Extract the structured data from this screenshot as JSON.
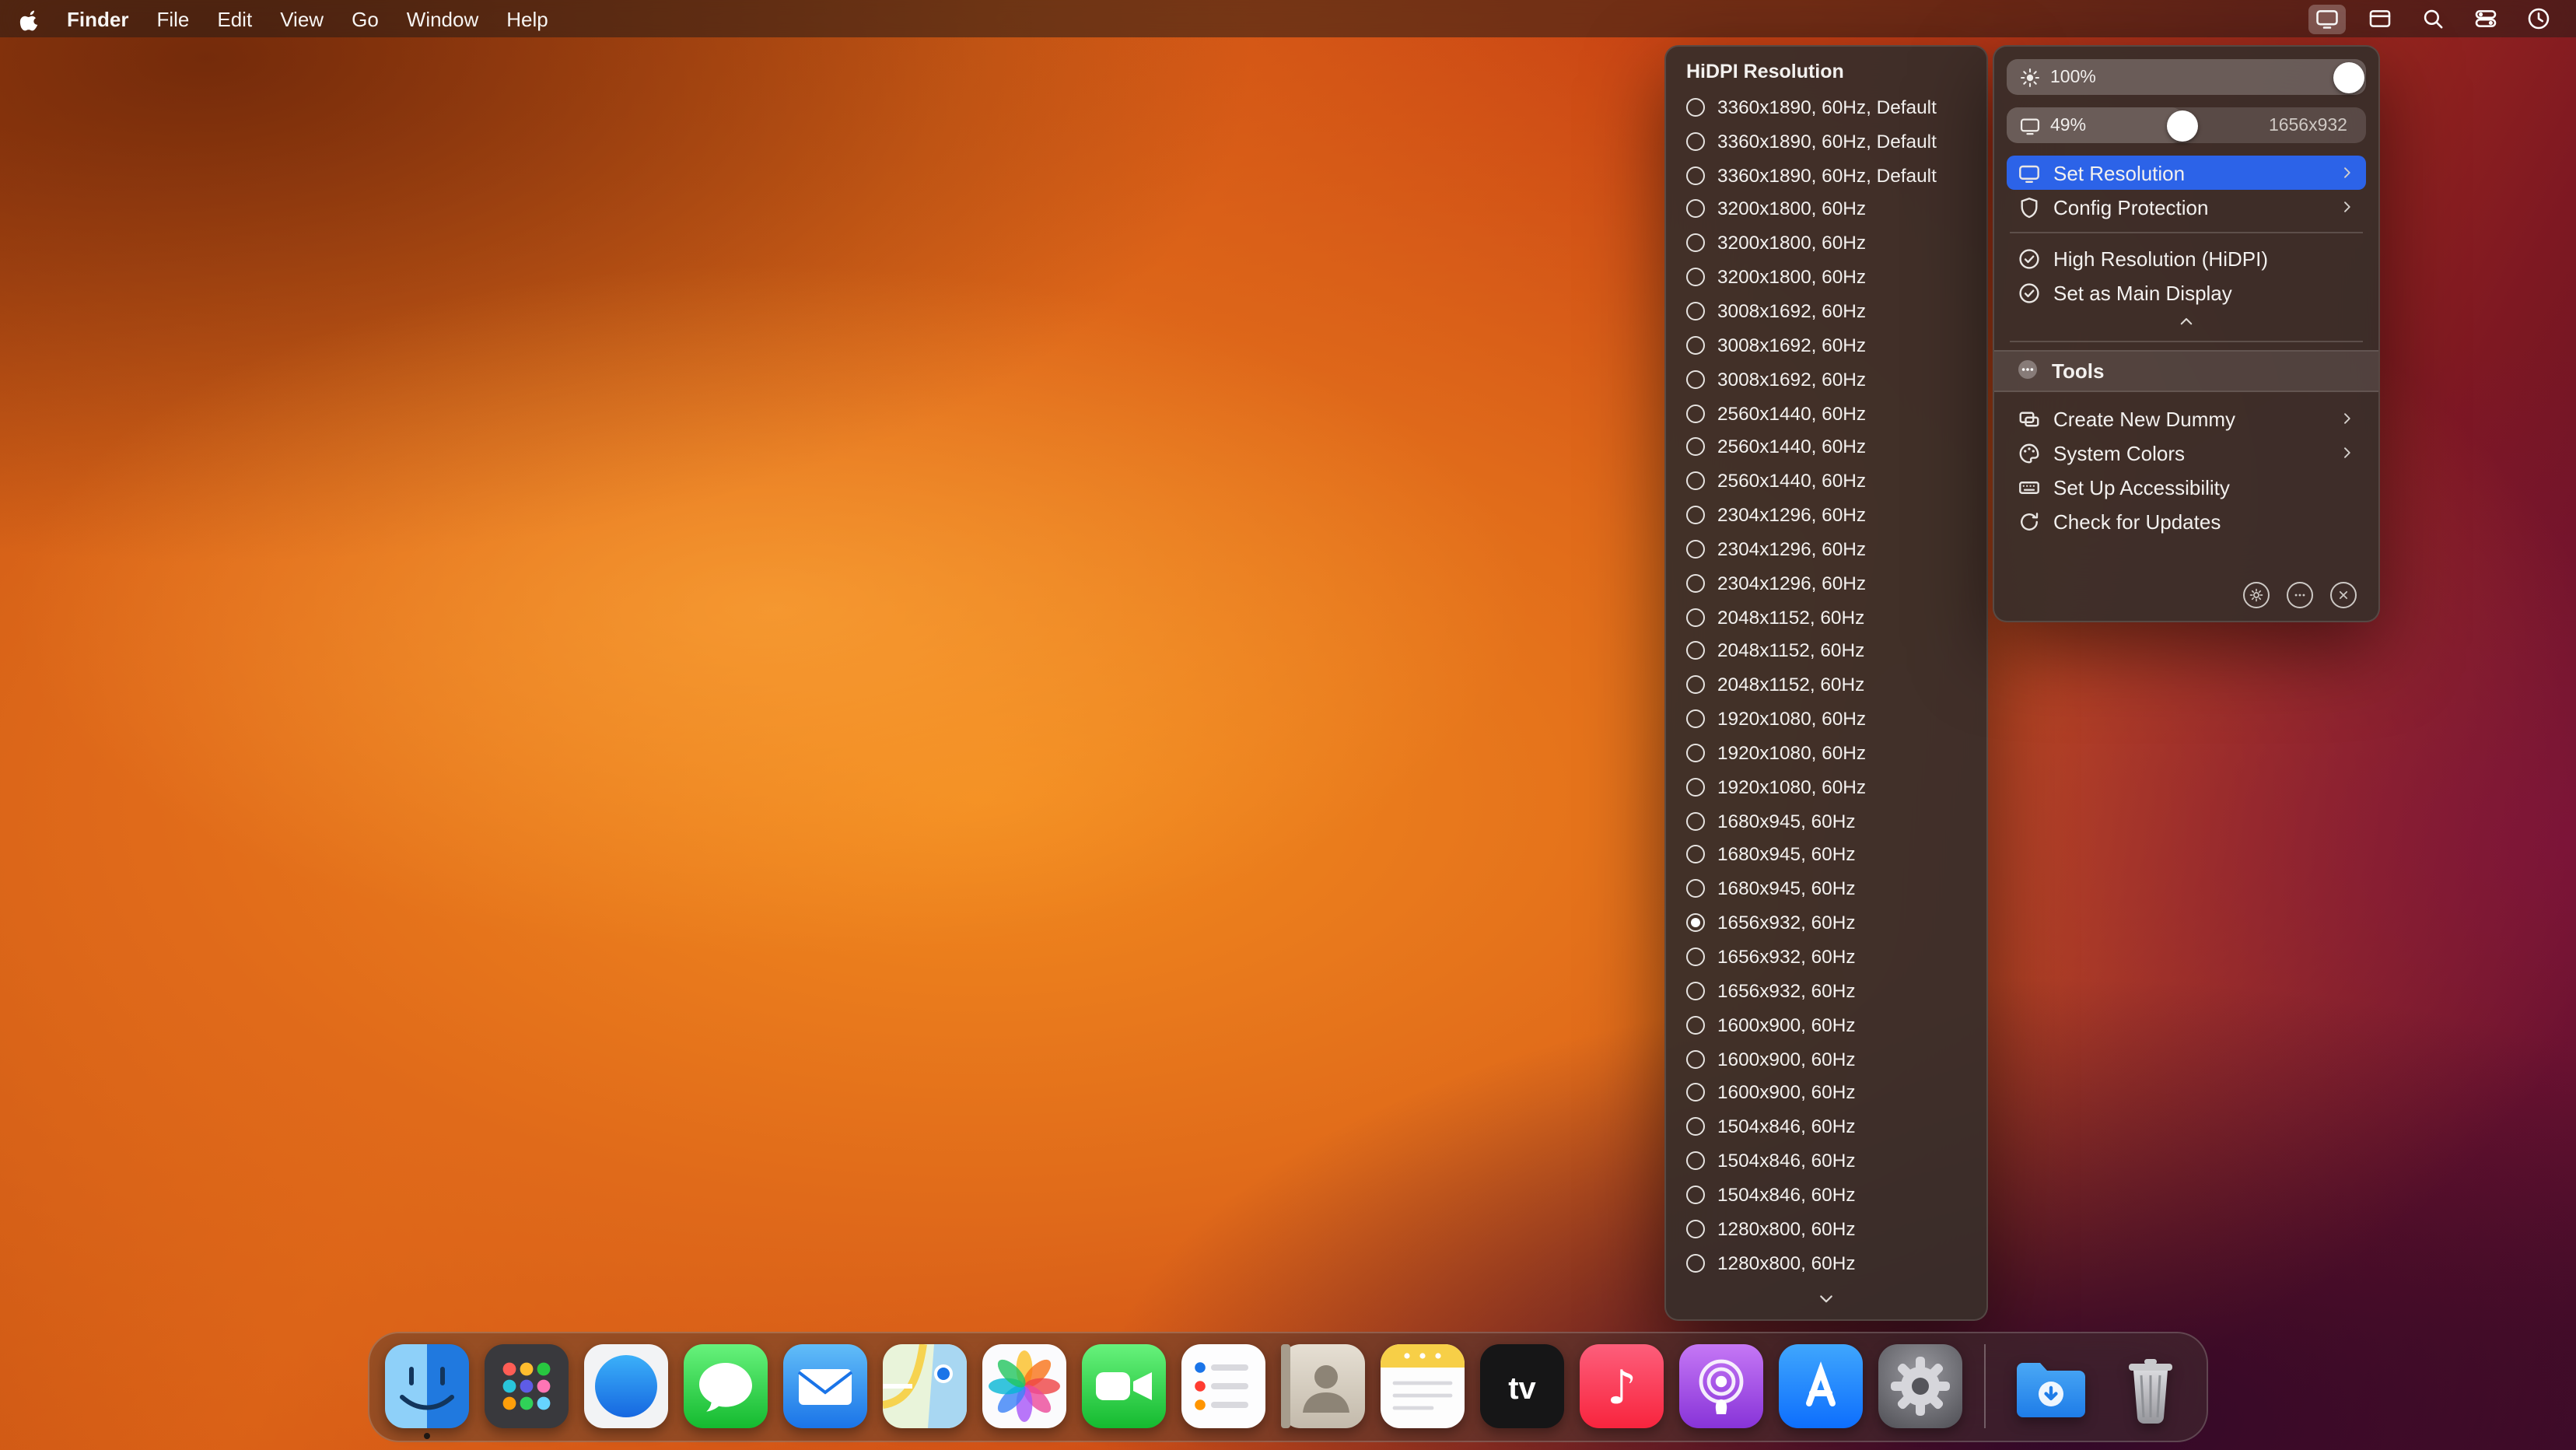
{
  "colors": {
    "accent_blue": "#2c63e8",
    "panel_bg": "#382f2a",
    "selected_radio": "#ffffff"
  },
  "menu_bar": {
    "app_name": "Finder",
    "menus": [
      "File",
      "Edit",
      "View",
      "Go",
      "Window",
      "Help"
    ],
    "status_icons": [
      {
        "name": "display-icon",
        "active": true
      },
      {
        "name": "window-icon",
        "active": false
      },
      {
        "name": "search-icon",
        "active": false
      },
      {
        "name": "control-center-icon",
        "active": false
      },
      {
        "name": "clock-icon",
        "active": false
      }
    ]
  },
  "resolution_submenu": {
    "title": "HiDPI Resolution",
    "selected_index": 24,
    "options": [
      "3360x1890, 60Hz, Default",
      "3360x1890, 60Hz, Default",
      "3360x1890, 60Hz, Default",
      "3200x1800, 60Hz",
      "3200x1800, 60Hz",
      "3200x1800, 60Hz",
      "3008x1692, 60Hz",
      "3008x1692, 60Hz",
      "3008x1692, 60Hz",
      "2560x1440, 60Hz",
      "2560x1440, 60Hz",
      "2560x1440, 60Hz",
      "2304x1296, 60Hz",
      "2304x1296, 60Hz",
      "2304x1296, 60Hz",
      "2048x1152, 60Hz",
      "2048x1152, 60Hz",
      "2048x1152, 60Hz",
      "1920x1080, 60Hz",
      "1920x1080, 60Hz",
      "1920x1080, 60Hz",
      "1680x945, 60Hz",
      "1680x945, 60Hz",
      "1680x945, 60Hz",
      "1656x932, 60Hz",
      "1656x932, 60Hz",
      "1656x932, 60Hz",
      "1600x900, 60Hz",
      "1600x900, 60Hz",
      "1600x900, 60Hz",
      "1504x846, 60Hz",
      "1504x846, 60Hz",
      "1504x846, 60Hz",
      "1280x800, 60Hz",
      "1280x800, 60Hz"
    ]
  },
  "main_panel": {
    "brightness": {
      "icon": "sun-icon",
      "value": "100%",
      "percent": 100
    },
    "resolution_slider": {
      "icon": "display-icon",
      "value": "49%",
      "percent": 49,
      "label": "1656x932"
    },
    "items": [
      {
        "type": "item",
        "label": "Set Resolution",
        "icon": "display-icon",
        "chevron": true,
        "highlighted": true
      },
      {
        "type": "item",
        "label": "Config Protection",
        "icon": "shield-icon",
        "chevron": true
      },
      {
        "type": "divider"
      },
      {
        "type": "item",
        "label": "High Resolution (HiDPI)",
        "icon": "check-circle-icon"
      },
      {
        "type": "item",
        "label": "Set as Main Display",
        "icon": "check-circle-icon"
      },
      {
        "type": "collapse",
        "icon": "chevron-up-icon"
      },
      {
        "type": "divider"
      },
      {
        "type": "header",
        "label": "Tools",
        "icon": "ellipsis-circle-icon"
      },
      {
        "type": "item",
        "label": "Create New Dummy",
        "icon": "dummy-display-icon",
        "chevron": true
      },
      {
        "type": "item",
        "label": "System Colors",
        "icon": "color-palette-icon",
        "chevron": true
      },
      {
        "type": "item",
        "label": "Set Up Accessibility",
        "icon": "keyboard-icon"
      },
      {
        "type": "item",
        "label": "Check for Updates",
        "icon": "refresh-icon"
      }
    ],
    "footer_icons": [
      {
        "name": "settings-gear-icon"
      },
      {
        "name": "more-ellipsis-icon"
      },
      {
        "name": "close-icon"
      }
    ]
  },
  "dock": {
    "apps": [
      {
        "name": "Finder",
        "icon": "finder",
        "running": true
      },
      {
        "name": "Launchpad",
        "icon": "launchpad"
      },
      {
        "name": "Safari",
        "icon": "safari"
      },
      {
        "name": "Messages",
        "icon": "messages"
      },
      {
        "name": "Mail",
        "icon": "mail"
      },
      {
        "name": "Maps",
        "icon": "maps"
      },
      {
        "name": "Photos",
        "icon": "photos"
      },
      {
        "name": "FaceTime",
        "icon": "facetime"
      },
      {
        "name": "Reminders",
        "icon": "reminders"
      },
      {
        "name": "Contacts",
        "icon": "contacts"
      },
      {
        "name": "Notes",
        "icon": "notes"
      },
      {
        "name": "TV",
        "icon": "tv"
      },
      {
        "name": "Music",
        "icon": "music"
      },
      {
        "name": "Podcasts",
        "icon": "podcasts"
      },
      {
        "name": "App Store",
        "icon": "appstore"
      },
      {
        "name": "System Settings",
        "icon": "settings"
      },
      {
        "type": "separator"
      },
      {
        "name": "Downloads",
        "icon": "downloads"
      },
      {
        "name": "Trash",
        "icon": "trash"
      }
    ]
  }
}
